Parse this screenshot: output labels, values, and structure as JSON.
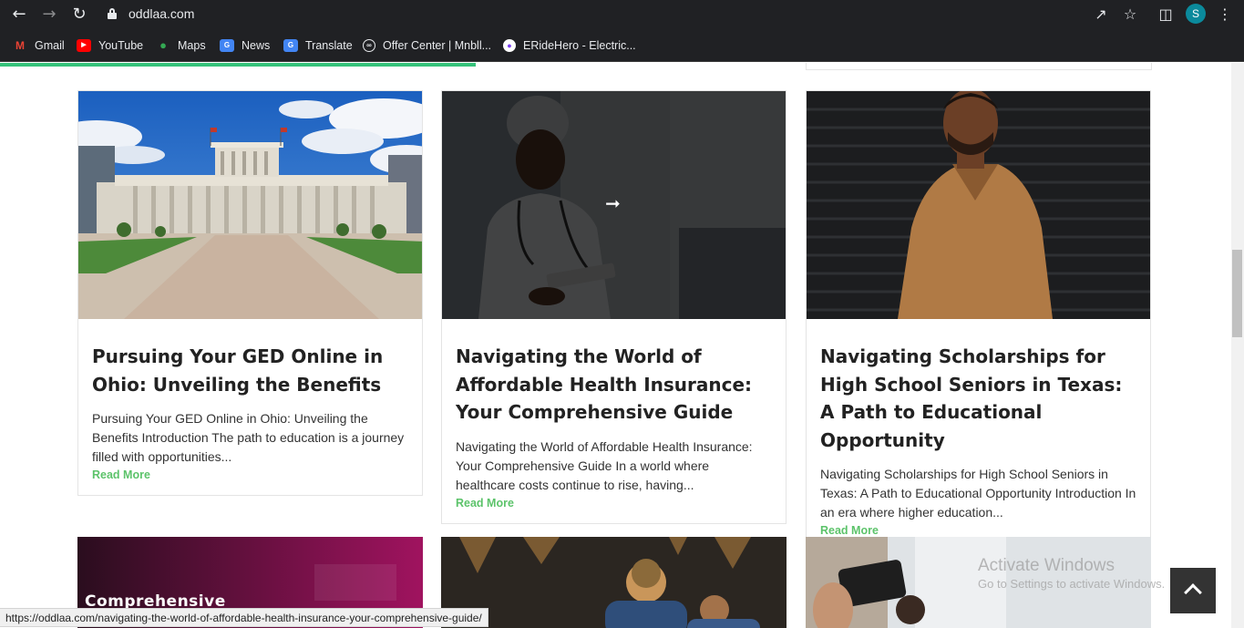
{
  "browser": {
    "url": "oddlaa.com",
    "profile_initial": "S",
    "bookmarks": [
      {
        "label": "Gmail",
        "icon": "gmail-icon"
      },
      {
        "label": "YouTube",
        "icon": "youtube-icon"
      },
      {
        "label": "Maps",
        "icon": "maps-icon"
      },
      {
        "label": "News",
        "icon": "news-icon"
      },
      {
        "label": "Translate",
        "icon": "translate-icon"
      },
      {
        "label": "Offer Center | Mnbll...",
        "icon": "offer-center-icon"
      },
      {
        "label": "ERideHero - Electric...",
        "icon": "eridehero-icon"
      }
    ],
    "load_progress_percent": 38,
    "status_url": "https://oddlaa.com/navigating-the-world-of-affordable-health-insurance-your-comprehensive-guide/"
  },
  "posts": [
    {
      "title": "Pursuing Your GED Online in Ohio: Unveiling the Benefits",
      "excerpt": "Pursuing Your GED Online in Ohio: Unveiling the Benefits Introduction The path to education is a journey filled with opportunities...",
      "read_more": "Read More",
      "image": "capitol-building-photo"
    },
    {
      "title": "Navigating the World of Affordable Health Insurance: Your Comprehensive Guide",
      "excerpt": "Navigating the World of Affordable Health Insurance: Your Comprehensive Guide In a world where healthcare costs continue to rise, having...",
      "read_more": "Read More",
      "image": "doctor-photo",
      "hover_arrow": "➞"
    },
    {
      "title": "Navigating Scholarships for High School Seniors in Texas: A Path to Educational Opportunity",
      "excerpt": "Navigating Scholarships for High School Seniors in Texas: A Path to Educational Opportunity Introduction In an era where higher education...",
      "read_more": "Read More",
      "image": "man-in-coat-photo"
    }
  ],
  "next_row": {
    "first_image_text": "Comprehensive"
  },
  "watermark": {
    "line1": "Activate Windows",
    "line2": "Go to Settings to activate Windows."
  },
  "colors": {
    "accent": "#5cc36a",
    "chrome": "#202124",
    "progress": "#35c27a"
  }
}
